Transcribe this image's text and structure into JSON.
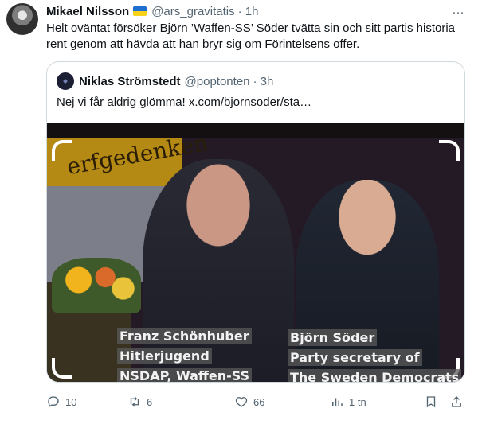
{
  "post": {
    "author": "Mikael Nilsson",
    "handle": "@ars_gravitatis",
    "time": "· 1h",
    "text": "Helt oväntat försöker Björn ’Waffen-SS’ Söder tvätta sin och sitt partis historia rent genom att hävda att han bryr sig om Förintelsens offer.",
    "more_icon": "…"
  },
  "quote": {
    "author": "Niklas Strömstedt",
    "handle": "@poptonten",
    "time": "· 3h",
    "text": "Nej vi får aldrig glömma!  x.com/bjornsoder/sta…",
    "image": {
      "banner_text": "erfgedenken",
      "caption_left": [
        "Franz Schönhuber",
        "Hitlerjugend",
        "NSDAP, Waffen-SS"
      ],
      "caption_right": [
        "Björn Söder",
        "Party secretary  of",
        "The Sweden Democrats"
      ]
    }
  },
  "actions": {
    "replies": "10",
    "reposts": "6",
    "likes": "66",
    "views": "1 tn"
  },
  "colors": {
    "text": "#0f1419",
    "muted": "#536471",
    "border": "#cfd9de"
  },
  "icons": [
    "avatar",
    "ukraine-flag-icon",
    "more-icon",
    "reply-icon",
    "repost-icon",
    "like-icon",
    "views-icon",
    "bookmark-icon",
    "share-icon"
  ]
}
